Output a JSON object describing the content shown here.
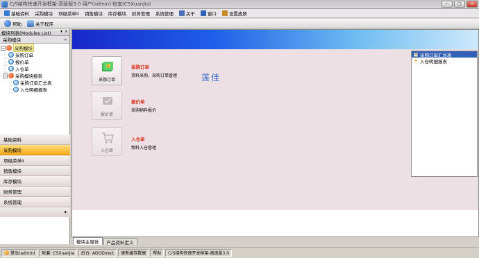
{
  "window": {
    "title": "C/S结构快速开发框架-高级版3.0 用户(admin) 帐套(CSXuanJia)",
    "min": "—",
    "max": "□",
    "close": "×"
  },
  "menubar": {
    "items": [
      {
        "label": "基础资料",
        "icon": "grid-icon",
        "color": "#3a7bd5"
      },
      {
        "label": "采购模块",
        "icon": "",
        "color": ""
      },
      {
        "label": "项级菜单II",
        "icon": "",
        "color": ""
      },
      {
        "label": "销售模块",
        "icon": "",
        "color": ""
      },
      {
        "label": "库存模块",
        "icon": "",
        "color": ""
      },
      {
        "label": "财务管理",
        "icon": "",
        "color": ""
      },
      {
        "label": "系统管理",
        "icon": "",
        "color": ""
      },
      {
        "label": "关于",
        "icon": "about-icon",
        "color": "#4a6fb5"
      },
      {
        "label": "窗口",
        "icon": "window-icon",
        "color": "#2f63b8"
      },
      {
        "label": "设置皮肤",
        "icon": "skin-icon",
        "color": "#c98b2a"
      }
    ]
  },
  "toolbar": {
    "help_label": "帮助",
    "about_label": "关于程序"
  },
  "left_panel": {
    "header": "模块列表(Modules List)",
    "header_pin": "▾",
    "header_close": "×",
    "subheader": "采购模块",
    "collapse": "«",
    "tree": {
      "root": "采购模块",
      "items": [
        "采购订单",
        "报价单",
        "入仓单"
      ],
      "report_group": "采购模块报表",
      "report_items": [
        "采购订单汇总表",
        "入仓明细报表"
      ]
    },
    "splitter": "·····",
    "modules": [
      "基础资料",
      "采购模块",
      "项级菜单II",
      "销售模块",
      "库存模块",
      "财务管理",
      "系统管理"
    ],
    "active_module": "采购模块",
    "bottom_arrow": "▾"
  },
  "main": {
    "watermark": "莲佳",
    "cards": [
      {
        "label": "采购订单",
        "title": "采购订单",
        "desc": "货料采购，采购订单管理",
        "enabled": true
      },
      {
        "label": "报价单",
        "title": "报价单",
        "desc": "采购物料报价",
        "enabled": false
      },
      {
        "label": "入仓单",
        "title": "入仓单",
        "desc": "物料入仓管理",
        "enabled": false
      }
    ],
    "reports": [
      {
        "label": "采购订单汇总表",
        "selected": true
      },
      {
        "label": "入仓明细报表",
        "selected": false
      }
    ]
  },
  "tabs": [
    {
      "label": "模块主窗体",
      "active": true
    },
    {
      "label": "产品资料定义",
      "active": false
    }
  ],
  "statusbar": {
    "login": "登出(admin)",
    "account": "帐套: CSXuanJia",
    "backend": "后台: ADODirect",
    "refresh": "更新缓存数据",
    "help": "帮助",
    "product": "C/S结构快速开发框架-高级版3.0"
  },
  "colors": {
    "accent_orange": "#f5a818",
    "selection_blue": "#3262b6",
    "card_title_red": "#d9301b",
    "content_bg": "#ece0e4"
  }
}
